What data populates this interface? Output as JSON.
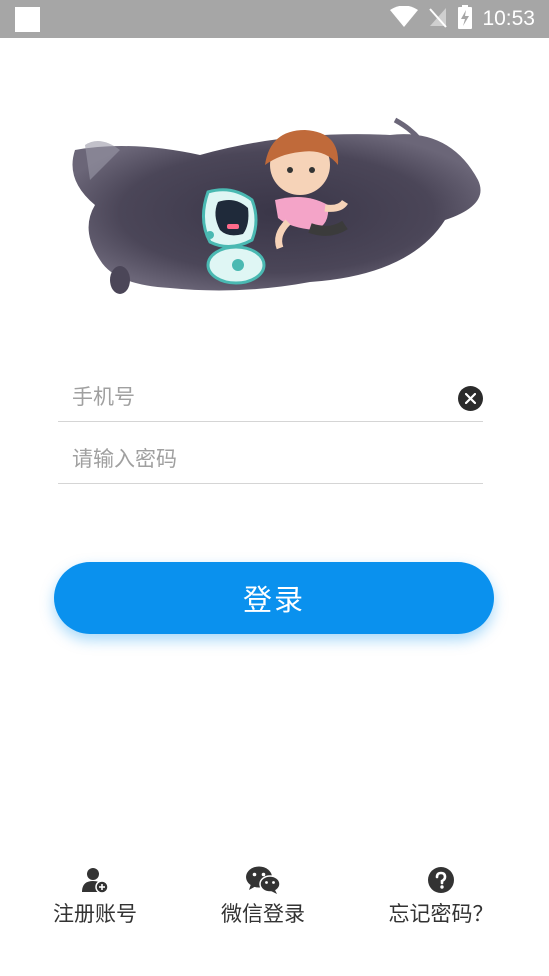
{
  "status_bar": {
    "time": "10:53",
    "icons": [
      "notification-square-icon",
      "wifi-icon",
      "no-signal-icon",
      "battery-charging-icon"
    ]
  },
  "illustration": {
    "description_icon": "cartoon-boy-with-robot-illustration"
  },
  "form": {
    "phone_placeholder": "手机号",
    "phone_value": "",
    "password_placeholder": "请输入密码",
    "password_value": "",
    "clear_icon": "clear-icon"
  },
  "login_button": {
    "label": "登录",
    "color": "#0a91ee"
  },
  "bottom_actions": [
    {
      "label": "注册账号",
      "icon": "add-user-icon"
    },
    {
      "label": "微信登录",
      "icon": "wechat-icon"
    },
    {
      "label": "忘记密码？",
      "icon": "question-icon"
    }
  ]
}
